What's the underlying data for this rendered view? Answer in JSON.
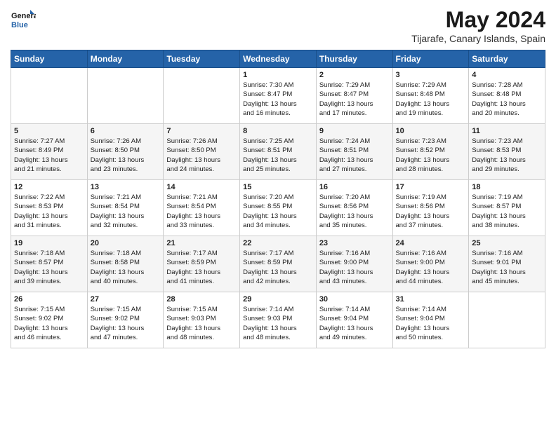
{
  "logo": {
    "line1": "General",
    "line2": "Blue"
  },
  "title": "May 2024",
  "subtitle": "Tijarafe, Canary Islands, Spain",
  "weekdays": [
    "Sunday",
    "Monday",
    "Tuesday",
    "Wednesday",
    "Thursday",
    "Friday",
    "Saturday"
  ],
  "rows": [
    [
      {
        "day": "",
        "info": ""
      },
      {
        "day": "",
        "info": ""
      },
      {
        "day": "",
        "info": ""
      },
      {
        "day": "1",
        "info": "Sunrise: 7:30 AM\nSunset: 8:47 PM\nDaylight: 13 hours\nand 16 minutes."
      },
      {
        "day": "2",
        "info": "Sunrise: 7:29 AM\nSunset: 8:47 PM\nDaylight: 13 hours\nand 17 minutes."
      },
      {
        "day": "3",
        "info": "Sunrise: 7:29 AM\nSunset: 8:48 PM\nDaylight: 13 hours\nand 19 minutes."
      },
      {
        "day": "4",
        "info": "Sunrise: 7:28 AM\nSunset: 8:48 PM\nDaylight: 13 hours\nand 20 minutes."
      }
    ],
    [
      {
        "day": "5",
        "info": "Sunrise: 7:27 AM\nSunset: 8:49 PM\nDaylight: 13 hours\nand 21 minutes."
      },
      {
        "day": "6",
        "info": "Sunrise: 7:26 AM\nSunset: 8:50 PM\nDaylight: 13 hours\nand 23 minutes."
      },
      {
        "day": "7",
        "info": "Sunrise: 7:26 AM\nSunset: 8:50 PM\nDaylight: 13 hours\nand 24 minutes."
      },
      {
        "day": "8",
        "info": "Sunrise: 7:25 AM\nSunset: 8:51 PM\nDaylight: 13 hours\nand 25 minutes."
      },
      {
        "day": "9",
        "info": "Sunrise: 7:24 AM\nSunset: 8:51 PM\nDaylight: 13 hours\nand 27 minutes."
      },
      {
        "day": "10",
        "info": "Sunrise: 7:23 AM\nSunset: 8:52 PM\nDaylight: 13 hours\nand 28 minutes."
      },
      {
        "day": "11",
        "info": "Sunrise: 7:23 AM\nSunset: 8:53 PM\nDaylight: 13 hours\nand 29 minutes."
      }
    ],
    [
      {
        "day": "12",
        "info": "Sunrise: 7:22 AM\nSunset: 8:53 PM\nDaylight: 13 hours\nand 31 minutes."
      },
      {
        "day": "13",
        "info": "Sunrise: 7:21 AM\nSunset: 8:54 PM\nDaylight: 13 hours\nand 32 minutes."
      },
      {
        "day": "14",
        "info": "Sunrise: 7:21 AM\nSunset: 8:54 PM\nDaylight: 13 hours\nand 33 minutes."
      },
      {
        "day": "15",
        "info": "Sunrise: 7:20 AM\nSunset: 8:55 PM\nDaylight: 13 hours\nand 34 minutes."
      },
      {
        "day": "16",
        "info": "Sunrise: 7:20 AM\nSunset: 8:56 PM\nDaylight: 13 hours\nand 35 minutes."
      },
      {
        "day": "17",
        "info": "Sunrise: 7:19 AM\nSunset: 8:56 PM\nDaylight: 13 hours\nand 37 minutes."
      },
      {
        "day": "18",
        "info": "Sunrise: 7:19 AM\nSunset: 8:57 PM\nDaylight: 13 hours\nand 38 minutes."
      }
    ],
    [
      {
        "day": "19",
        "info": "Sunrise: 7:18 AM\nSunset: 8:57 PM\nDaylight: 13 hours\nand 39 minutes."
      },
      {
        "day": "20",
        "info": "Sunrise: 7:18 AM\nSunset: 8:58 PM\nDaylight: 13 hours\nand 40 minutes."
      },
      {
        "day": "21",
        "info": "Sunrise: 7:17 AM\nSunset: 8:59 PM\nDaylight: 13 hours\nand 41 minutes."
      },
      {
        "day": "22",
        "info": "Sunrise: 7:17 AM\nSunset: 8:59 PM\nDaylight: 13 hours\nand 42 minutes."
      },
      {
        "day": "23",
        "info": "Sunrise: 7:16 AM\nSunset: 9:00 PM\nDaylight: 13 hours\nand 43 minutes."
      },
      {
        "day": "24",
        "info": "Sunrise: 7:16 AM\nSunset: 9:00 PM\nDaylight: 13 hours\nand 44 minutes."
      },
      {
        "day": "25",
        "info": "Sunrise: 7:16 AM\nSunset: 9:01 PM\nDaylight: 13 hours\nand 45 minutes."
      }
    ],
    [
      {
        "day": "26",
        "info": "Sunrise: 7:15 AM\nSunset: 9:02 PM\nDaylight: 13 hours\nand 46 minutes."
      },
      {
        "day": "27",
        "info": "Sunrise: 7:15 AM\nSunset: 9:02 PM\nDaylight: 13 hours\nand 47 minutes."
      },
      {
        "day": "28",
        "info": "Sunrise: 7:15 AM\nSunset: 9:03 PM\nDaylight: 13 hours\nand 48 minutes."
      },
      {
        "day": "29",
        "info": "Sunrise: 7:14 AM\nSunset: 9:03 PM\nDaylight: 13 hours\nand 48 minutes."
      },
      {
        "day": "30",
        "info": "Sunrise: 7:14 AM\nSunset: 9:04 PM\nDaylight: 13 hours\nand 49 minutes."
      },
      {
        "day": "31",
        "info": "Sunrise: 7:14 AM\nSunset: 9:04 PM\nDaylight: 13 hours\nand 50 minutes."
      },
      {
        "day": "",
        "info": ""
      }
    ]
  ]
}
